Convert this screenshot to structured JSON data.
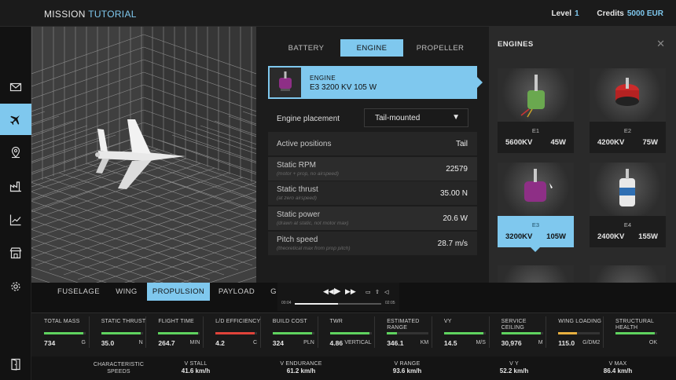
{
  "topbar": {
    "title_prefix": "MISSION",
    "title_highlight": "TUTORIAL",
    "level_label": "Level",
    "level_value": "1",
    "credits_label": "Credits",
    "credits_value": "5000 EUR"
  },
  "sidebar": {
    "items": [
      {
        "icon": "mail-icon"
      },
      {
        "icon": "airplane-icon",
        "active": true
      },
      {
        "icon": "map-pin-icon"
      },
      {
        "icon": "factory-icon"
      },
      {
        "icon": "chart-icon"
      },
      {
        "icon": "store-icon"
      },
      {
        "icon": "gear-icon"
      },
      {
        "icon": "exit-icon"
      }
    ]
  },
  "component_tabs": [
    {
      "label": "BATTERY"
    },
    {
      "label": "ENGINE",
      "active": true
    },
    {
      "label": "PROPELLER"
    }
  ],
  "selected_engine": {
    "label": "ENGINE",
    "name": "E3 3200 KV 105 W"
  },
  "placement": {
    "label": "Engine placement",
    "value": "Tail-mounted",
    "arrow": "▼"
  },
  "specs": [
    {
      "key": "Active positions",
      "sub": "",
      "value": "Tail"
    },
    {
      "key": "Static RPM",
      "sub": "(motor + prop, no airspeed)",
      "value": "22579"
    },
    {
      "key": "Static thrust",
      "sub": "(at zero airspeed)",
      "value": "35.00 N"
    },
    {
      "key": "Static power",
      "sub": "(drawn at static, not motor max)",
      "value": "20.6 W"
    },
    {
      "key": "Pitch speed",
      "sub": "(theoretical max from prop pitch)",
      "value": "28.7 m/s"
    }
  ],
  "engines_panel": {
    "title": "ENGINES",
    "close": "✕",
    "cards": [
      {
        "id": "E1",
        "kv": "5600KV",
        "w": "45W",
        "color": "#6aa84f"
      },
      {
        "id": "E2",
        "kv": "4200KV",
        "w": "75W",
        "color": "#cc2b2b"
      },
      {
        "id": "E3",
        "kv": "3200KV",
        "w": "105W",
        "color": "#8e2f86",
        "active": true
      },
      {
        "id": "E4",
        "kv": "2400KV",
        "w": "155W",
        "color": "#2f6fb3"
      }
    ]
  },
  "bottom_tabs": [
    {
      "label": "FUSELAGE"
    },
    {
      "label": "WING"
    },
    {
      "label": "PROPULSION",
      "active": true
    },
    {
      "label": "PAYLOAD"
    },
    {
      "label": "G"
    }
  ],
  "video": {
    "time_start": "00:04",
    "time_end": "02:05",
    "progress": 0.5
  },
  "stats": [
    {
      "label": "TOTAL MASS",
      "value": "734",
      "unit": "G",
      "level": 0.95,
      "color": "#5fd35f"
    },
    {
      "label": "STATIC THRUST",
      "value": "35.0",
      "unit": "N",
      "level": 0.95,
      "color": "#5fd35f"
    },
    {
      "label": "FLIGHT TIME",
      "value": "264.7",
      "unit": "MIN",
      "level": 0.95,
      "color": "#5fd35f"
    },
    {
      "label": "L/D EFFICIENCY",
      "value": "4.2",
      "unit": "C",
      "level": 0.95,
      "color": "#e0433a"
    },
    {
      "label": "BUILD COST",
      "value": "324",
      "unit": "PLN",
      "level": 0.95,
      "color": "#5fd35f"
    },
    {
      "label": "TWR",
      "value": "4.86",
      "unit": "VERTICAL",
      "level": 0.95,
      "color": "#5fd35f"
    },
    {
      "label": "ESTIMATED RANGE",
      "value": "346.1",
      "unit": "KM",
      "level": 0.25,
      "color": "#5fd35f"
    },
    {
      "label": "VY",
      "value": "14.5",
      "unit": "M/S",
      "level": 0.95,
      "color": "#5fd35f"
    },
    {
      "label": "SERVICE CEILING",
      "value": "30,976",
      "unit": "M",
      "level": 0.95,
      "color": "#5fd35f"
    },
    {
      "label": "WING LOADING",
      "value": "115.0",
      "unit": "G/DM2",
      "level": 0.45,
      "color": "#e8b040"
    },
    {
      "label": "STRUCTURAL HEALTH",
      "value": "",
      "unit": "OK",
      "level": 0.95,
      "color": "#5fd35f"
    }
  ],
  "speeds": {
    "label": "CHARACTERISTIC SPEEDS",
    "items": [
      {
        "label": "V STALL",
        "value": "41.6 km/h"
      },
      {
        "label": "V ENDURANCE",
        "value": "61.2 km/h"
      },
      {
        "label": "V RANGE",
        "value": "93.6 km/h"
      },
      {
        "label": "V Y",
        "value": "52.2 km/h"
      },
      {
        "label": "V MAX",
        "value": "86.4 km/h"
      }
    ]
  }
}
